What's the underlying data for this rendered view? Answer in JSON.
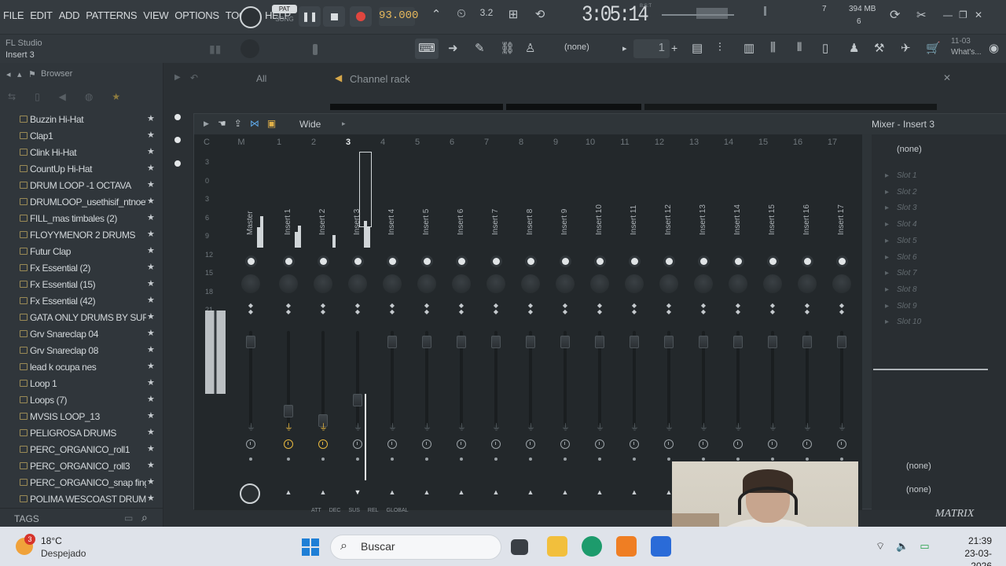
{
  "menu": [
    "FILE",
    "EDIT",
    "ADD",
    "PATTERNS",
    "VIEW",
    "OPTIONS",
    "TOOLS",
    "HELP"
  ],
  "transport": {
    "pat_label": "PAT",
    "song_label": "SONG",
    "tempo": "93.000"
  },
  "time": {
    "display": "3:05:14",
    "bst": "B:S:T"
  },
  "cpu": {
    "voices": "7",
    "memory": "394 MB",
    "polyphony": "6"
  },
  "hint": {
    "app": "FL Studio",
    "target": "Insert 3"
  },
  "toolbar2": {
    "pattern_selector": "(none)",
    "pattern_number": "1",
    "plus": "+",
    "news_date": "11-03",
    "news_text": "What's..."
  },
  "browser": {
    "title": "Browser",
    "items": [
      "Buzzin Hi-Hat",
      "Clap1",
      "Clink Hi-Hat",
      "CountUp Hi-Hat",
      "DRUM LOOP -1 OCTAVA",
      "DRUMLOOP_usethisif_ntnoeffort1_808PM",
      "FILL_mas timbales (2)",
      "FLOYYMENOR 2 DRUMS",
      "Futur Clap",
      "Fx Essential (2)",
      "Fx Essential (15)",
      "Fx Essential (42)",
      "GATA ONLY DRUMS BY SURYONTHESHEET",
      "Grv Snareclap 04",
      "Grv Snareclap 08",
      "lead k ocupa nes",
      "Loop 1",
      "Loops (7)",
      "MVSIS LOOP_13",
      "PELIGROSA DRUMS",
      "PERC_ORGANICO_roll1",
      "PERC_ORGANICO_roll3",
      "PERC_ORGANICO_snap finger",
      "POLIMA WESCOAST DRUMS"
    ],
    "tags_label": "TAGS"
  },
  "channel_rack": {
    "filter": "All",
    "title": "Channel rack"
  },
  "mixer": {
    "title": "Mixer - Insert 3",
    "layout_label": "Wide",
    "meter_scale": [
      "3",
      "0",
      "3",
      "6",
      "9",
      "12",
      "15",
      "18",
      "21"
    ],
    "numbers": [
      "C",
      "M",
      "1",
      "2",
      "3",
      "4",
      "5",
      "6",
      "7",
      "8",
      "9",
      "10",
      "11",
      "12",
      "13",
      "14",
      "15",
      "16",
      "17"
    ],
    "strips": [
      "Master",
      "Insert 1",
      "Insert 2",
      "Insert 3",
      "Insert 4",
      "Insert 5",
      "Insert 6",
      "Insert 7",
      "Insert 8",
      "Insert 9",
      "Insert 10",
      "Insert 11",
      "Insert 12",
      "Insert 13",
      "Insert 14",
      "Insert 15",
      "Insert 16",
      "Insert 17"
    ],
    "selected_insert": "3",
    "input": "(none)",
    "slots": [
      "Slot 1",
      "Slot 2",
      "Slot 3",
      "Slot 4",
      "Slot 5",
      "Slot 6",
      "Slot 7",
      "Slot 8",
      "Slot 9",
      "Slot 10"
    ],
    "output_1": "(none)",
    "output_2": "(none)",
    "env": [
      "ATT",
      "DEC",
      "SUS",
      "REL",
      "GLOBAL"
    ],
    "footer": "MATRIX"
  },
  "taskbar": {
    "weather_badge": "3",
    "temperature": "18°C",
    "weather": "Despejado",
    "search_placeholder": "Buscar",
    "time": "21:39",
    "date": "23-03-2026"
  }
}
